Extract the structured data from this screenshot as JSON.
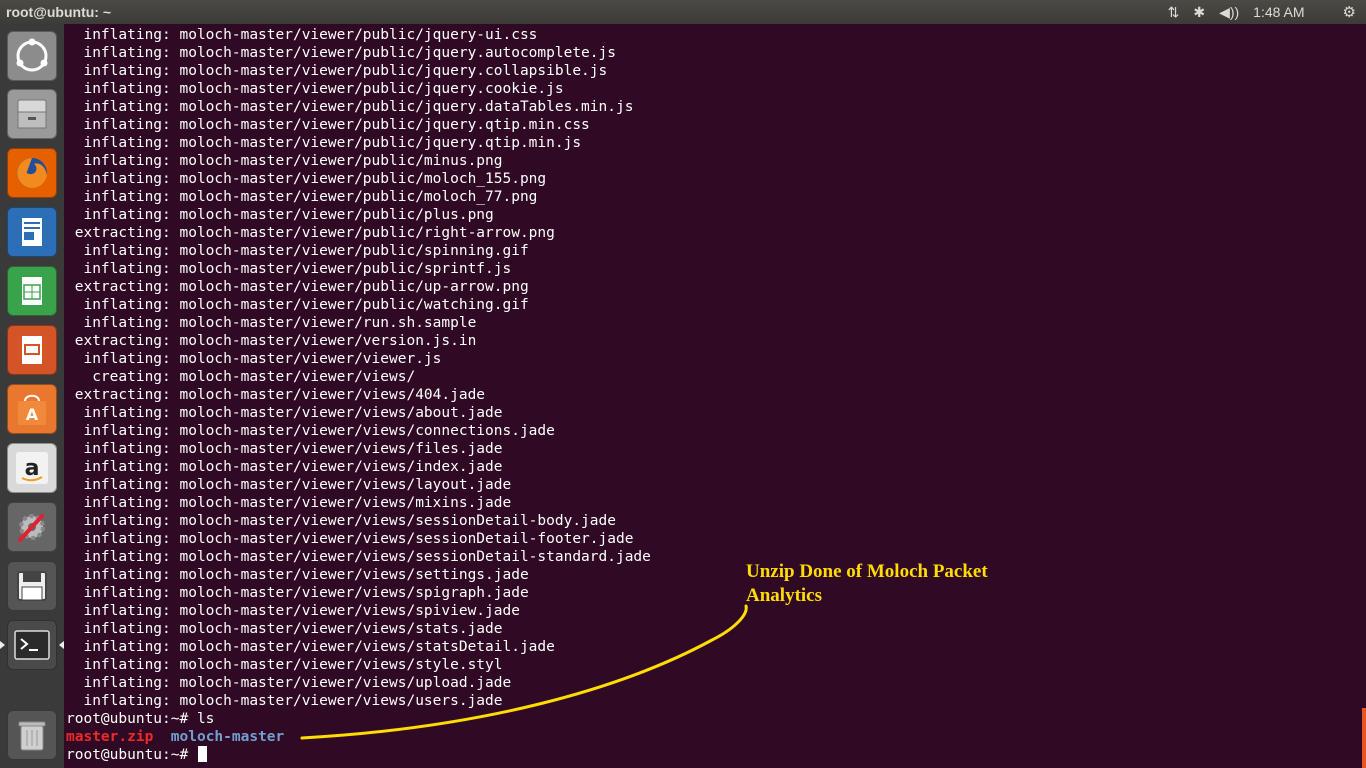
{
  "topbar": {
    "title": "root@ubuntu: ~",
    "network": "⇅",
    "bluetooth": "✱",
    "volume": "◀))",
    "clock": "1:48 AM"
  },
  "launcher": {
    "items": [
      {
        "name": "dash-home-icon",
        "color": "#8c8c8c"
      },
      {
        "name": "files-icon",
        "color": "#9a9a9a"
      },
      {
        "name": "firefox-icon",
        "color": "#e66000"
      },
      {
        "name": "writer-icon",
        "color": "#2c6fb7"
      },
      {
        "name": "calc-icon",
        "color": "#3aa24a"
      },
      {
        "name": "impress-icon",
        "color": "#d35427"
      },
      {
        "name": "software-center-icon",
        "color": "#e9782e"
      },
      {
        "name": "amazon-icon",
        "color": "#d9d9d9"
      },
      {
        "name": "system-settings-icon",
        "color": "#666666"
      },
      {
        "name": "save-icon",
        "color": "#555555"
      },
      {
        "name": "terminal-icon",
        "color": "#4a4a4a"
      },
      {
        "name": "trash-icon",
        "color": "#555555"
      }
    ]
  },
  "terminal": {
    "lines": [
      "  inflating: moloch-master/viewer/public/jquery-ui.css",
      "  inflating: moloch-master/viewer/public/jquery.autocomplete.js",
      "  inflating: moloch-master/viewer/public/jquery.collapsible.js",
      "  inflating: moloch-master/viewer/public/jquery.cookie.js",
      "  inflating: moloch-master/viewer/public/jquery.dataTables.min.js",
      "  inflating: moloch-master/viewer/public/jquery.qtip.min.css",
      "  inflating: moloch-master/viewer/public/jquery.qtip.min.js",
      "  inflating: moloch-master/viewer/public/minus.png",
      "  inflating: moloch-master/viewer/public/moloch_155.png",
      "  inflating: moloch-master/viewer/public/moloch_77.png",
      "  inflating: moloch-master/viewer/public/plus.png",
      " extracting: moloch-master/viewer/public/right-arrow.png",
      "  inflating: moloch-master/viewer/public/spinning.gif",
      "  inflating: moloch-master/viewer/public/sprintf.js",
      " extracting: moloch-master/viewer/public/up-arrow.png",
      "  inflating: moloch-master/viewer/public/watching.gif",
      "  inflating: moloch-master/viewer/run.sh.sample",
      " extracting: moloch-master/viewer/version.js.in",
      "  inflating: moloch-master/viewer/viewer.js",
      "   creating: moloch-master/viewer/views/",
      " extracting: moloch-master/viewer/views/404.jade",
      "  inflating: moloch-master/viewer/views/about.jade",
      "  inflating: moloch-master/viewer/views/connections.jade",
      "  inflating: moloch-master/viewer/views/files.jade",
      "  inflating: moloch-master/viewer/views/index.jade",
      "  inflating: moloch-master/viewer/views/layout.jade",
      "  inflating: moloch-master/viewer/views/mixins.jade",
      "  inflating: moloch-master/viewer/views/sessionDetail-body.jade",
      "  inflating: moloch-master/viewer/views/sessionDetail-footer.jade",
      "  inflating: moloch-master/viewer/views/sessionDetail-standard.jade",
      "  inflating: moloch-master/viewer/views/settings.jade",
      "  inflating: moloch-master/viewer/views/spigraph.jade",
      "  inflating: moloch-master/viewer/views/spiview.jade",
      "  inflating: moloch-master/viewer/views/stats.jade",
      "  inflating: moloch-master/viewer/views/statsDetail.jade",
      "  inflating: moloch-master/viewer/views/style.styl",
      "  inflating: moloch-master/viewer/views/upload.jade",
      "  inflating: moloch-master/viewer/views/users.jade"
    ],
    "prompt_ls": "root@ubuntu:~# ls",
    "ls_zip": "master.zip",
    "ls_dir": "moloch-master",
    "prompt_current": "root@ubuntu:~# "
  },
  "annotation": {
    "line1": "Unzip Done of Moloch Packet",
    "line2": "Analytics",
    "color": "#ffdd00"
  }
}
